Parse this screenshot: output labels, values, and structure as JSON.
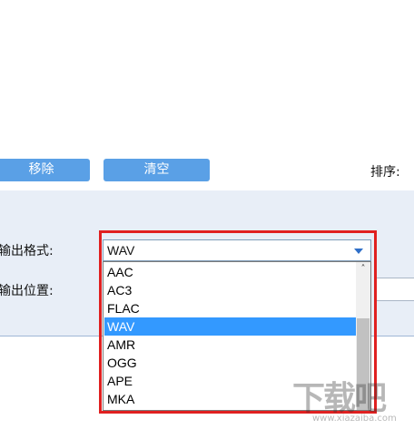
{
  "toolbar": {
    "remove_label": "移除",
    "clear_label": "清空",
    "sort_label": "排序:"
  },
  "settings": {
    "format_label": "输出格式:",
    "location_label": "输出位置:",
    "location_value": ""
  },
  "format_select": {
    "selected_value": "WAV",
    "options": [
      "AAC",
      "AC3",
      "FLAC",
      "WAV",
      "AMR",
      "OGG",
      "APE",
      "MKA"
    ],
    "highlighted_index": 3
  },
  "colors": {
    "button_bg": "#5aa0e6",
    "panel_bg": "#e8eef7",
    "highlight_border": "#e02020",
    "selected_item_bg": "#3399ff"
  },
  "icons": {
    "dropdown_arrow": "chevron-down-icon",
    "scroll_up": "chevron-up-icon"
  },
  "watermark": {
    "text": "下载吧",
    "url": "www.xiazaiba.com"
  }
}
